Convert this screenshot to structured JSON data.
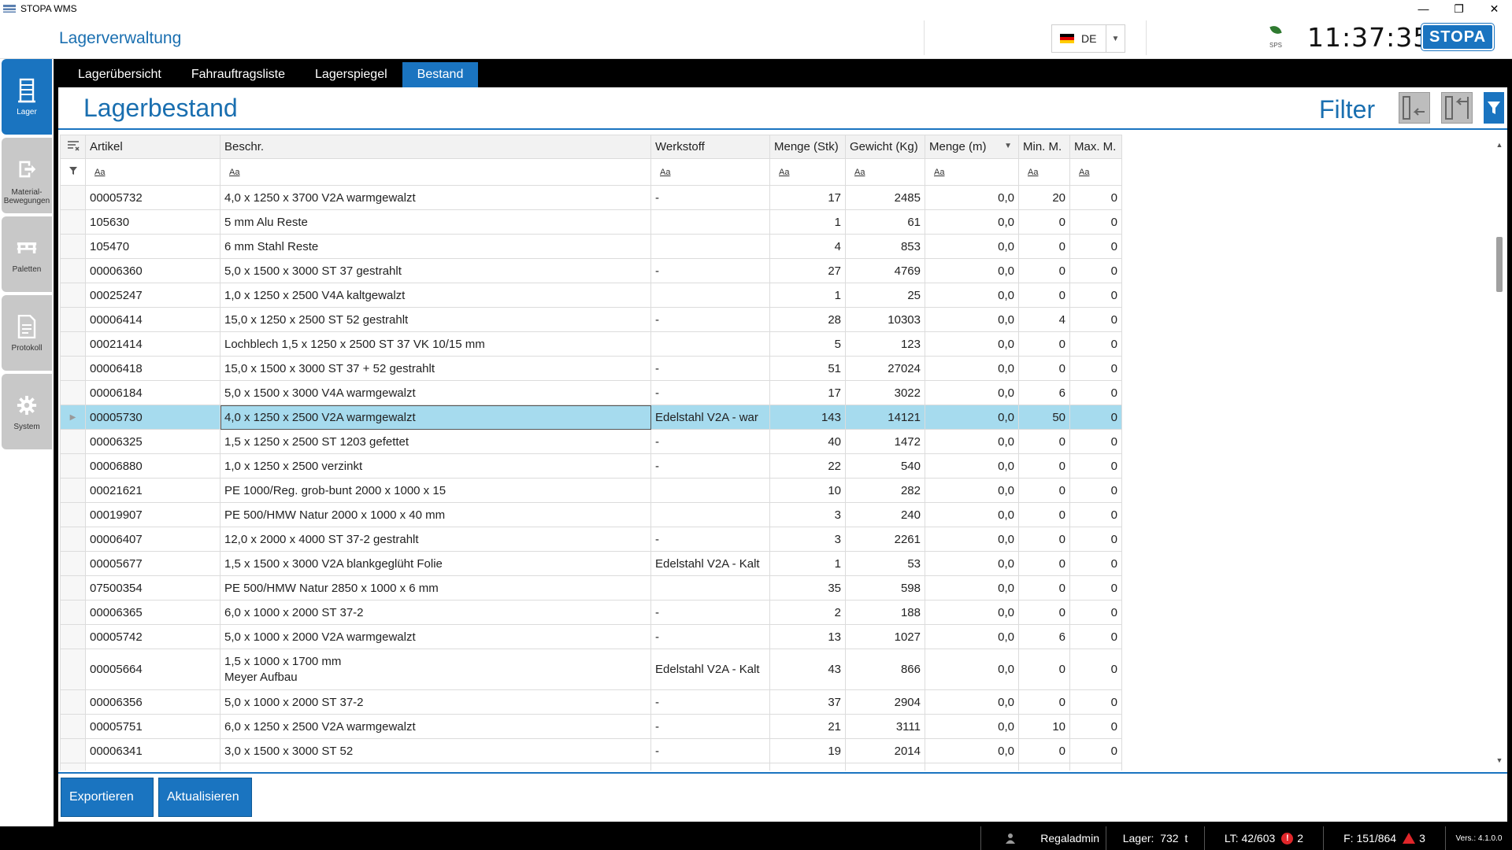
{
  "window": {
    "title": "STOPA WMS"
  },
  "header": {
    "heading": "Lagerverwaltung",
    "language": "DE",
    "sps_label": "SPS",
    "time": "11:37:35",
    "logo_text": "STOPA"
  },
  "sidebar": {
    "items": [
      {
        "label": "Lager",
        "icon": "warehouse-icon",
        "active": true
      },
      {
        "label": "Material-\nBewegungen",
        "icon": "material-movement-icon",
        "active": false
      },
      {
        "label": "Paletten",
        "icon": "pallet-icon",
        "active": false
      },
      {
        "label": "Protokoll",
        "icon": "document-icon",
        "active": false
      },
      {
        "label": "System",
        "icon": "gear-icon",
        "active": false
      }
    ]
  },
  "tabs": [
    {
      "label": "Lagerübersicht"
    },
    {
      "label": "Fahrauftragsliste"
    },
    {
      "label": "Lagerspiegel"
    },
    {
      "label": "Bestand",
      "active": true
    }
  ],
  "page": {
    "title": "Lagerbestand",
    "filter_label": "Filter"
  },
  "grid": {
    "columns": [
      {
        "label": "Artikel"
      },
      {
        "label": "Beschr."
      },
      {
        "label": "Werkstoff"
      },
      {
        "label": "Menge (Stk)"
      },
      {
        "label": "Gewicht (Kg)"
      },
      {
        "label": "Menge (m)"
      },
      {
        "label": "Min. M."
      },
      {
        "label": "Max. M."
      }
    ],
    "filter_placeholder": "Aa",
    "rows": [
      {
        "artikel": "00005732",
        "beschr": "4,0 x 1250 x 3700 V2A warmgewalzt",
        "werkstoff": "-",
        "stk": "17",
        "kg": "2485",
        "m": "0,0",
        "min": "20",
        "max": "0"
      },
      {
        "artikel": "105630",
        "beschr": "5 mm Alu Reste",
        "werkstoff": "",
        "stk": "1",
        "kg": "61",
        "m": "0,0",
        "min": "0",
        "max": "0"
      },
      {
        "artikel": "105470",
        "beschr": "6 mm Stahl Reste",
        "werkstoff": "",
        "stk": "4",
        "kg": "853",
        "m": "0,0",
        "min": "0",
        "max": "0"
      },
      {
        "artikel": "00006360",
        "beschr": "5,0 x 1500 x 3000 ST 37 gestrahlt",
        "werkstoff": "-",
        "stk": "27",
        "kg": "4769",
        "m": "0,0",
        "min": "0",
        "max": "0"
      },
      {
        "artikel": "00025247",
        "beschr": "1,0 x 1250 x 2500 V4A kaltgewalzt",
        "werkstoff": "",
        "stk": "1",
        "kg": "25",
        "m": "0,0",
        "min": "0",
        "max": "0"
      },
      {
        "artikel": "00006414",
        "beschr": "15,0 x 1250 x 2500 ST 52 gestrahlt",
        "werkstoff": "-",
        "stk": "28",
        "kg": "10303",
        "m": "0,0",
        "min": "4",
        "max": "0"
      },
      {
        "artikel": "00021414",
        "beschr": "Lochblech 1,5 x 1250 x 2500 ST 37 VK 10/15 mm",
        "werkstoff": "",
        "stk": "5",
        "kg": "123",
        "m": "0,0",
        "min": "0",
        "max": "0"
      },
      {
        "artikel": "00006418",
        "beschr": "15,0 x 1500 x 3000 ST 37 + 52 gestrahlt",
        "werkstoff": "-",
        "stk": "51",
        "kg": "27024",
        "m": "0,0",
        "min": "0",
        "max": "0"
      },
      {
        "artikel": "00006184",
        "beschr": "5,0 x 1500 x 3000 V4A warmgewalzt",
        "werkstoff": "-",
        "stk": "17",
        "kg": "3022",
        "m": "0,0",
        "min": "6",
        "max": "0"
      },
      {
        "artikel": "00005730",
        "beschr": "4,0 x 1250 x 2500 V2A warmgewalzt",
        "werkstoff": "Edelstahl V2A - war",
        "stk": "143",
        "kg": "14121",
        "m": "0,0",
        "min": "50",
        "max": "0",
        "selected": true
      },
      {
        "artikel": "00006325",
        "beschr": "1,5 x 1250 x 2500 ST 1203 gefettet",
        "werkstoff": "-",
        "stk": "40",
        "kg": "1472",
        "m": "0,0",
        "min": "0",
        "max": "0"
      },
      {
        "artikel": "00006880",
        "beschr": "1,0 x 1250 x 2500 verzinkt",
        "werkstoff": "-",
        "stk": "22",
        "kg": "540",
        "m": "0,0",
        "min": "0",
        "max": "0"
      },
      {
        "artikel": "00021621",
        "beschr": "PE 1000/Reg. grob-bunt 2000 x 1000 x 15",
        "werkstoff": "",
        "stk": "10",
        "kg": "282",
        "m": "0,0",
        "min": "0",
        "max": "0"
      },
      {
        "artikel": "00019907",
        "beschr": "PE 500/HMW Natur 2000 x 1000 x 40 mm",
        "werkstoff": "",
        "stk": "3",
        "kg": "240",
        "m": "0,0",
        "min": "0",
        "max": "0"
      },
      {
        "artikel": "00006407",
        "beschr": "12,0 x 2000 x 4000 ST 37-2 gestrahlt",
        "werkstoff": "-",
        "stk": "3",
        "kg": "2261",
        "m": "0,0",
        "min": "0",
        "max": "0"
      },
      {
        "artikel": "00005677",
        "beschr": "1,5 x 1500 x 3000 V2A blankgeglüht Folie",
        "werkstoff": "Edelstahl V2A - Kalt",
        "stk": "1",
        "kg": "53",
        "m": "0,0",
        "min": "0",
        "max": "0"
      },
      {
        "artikel": "07500354",
        "beschr": "PE 500/HMW Natur 2850 x 1000 x 6 mm",
        "werkstoff": "",
        "stk": "35",
        "kg": "598",
        "m": "0,0",
        "min": "0",
        "max": "0"
      },
      {
        "artikel": "00006365",
        "beschr": "6,0 x 1000 x 2000 ST 37-2",
        "werkstoff": "-",
        "stk": "2",
        "kg": "188",
        "m": "0,0",
        "min": "0",
        "max": "0"
      },
      {
        "artikel": "00005742",
        "beschr": "5,0 x 1000 x 2000 V2A warmgewalzt",
        "werkstoff": "-",
        "stk": "13",
        "kg": "1027",
        "m": "0,0",
        "min": "6",
        "max": "0"
      },
      {
        "artikel": "00005664",
        "beschr": "1,5 x 1000 x 1700 mm",
        "beschr2": "Meyer Aufbau",
        "werkstoff": "Edelstahl V2A - Kalt",
        "stk": "43",
        "kg": "866",
        "m": "0,0",
        "min": "0",
        "max": "0"
      },
      {
        "artikel": "00006356",
        "beschr": "5,0 x 1000 x 2000 ST 37-2",
        "werkstoff": "-",
        "stk": "37",
        "kg": "2904",
        "m": "0,0",
        "min": "0",
        "max": "0"
      },
      {
        "artikel": "00005751",
        "beschr": "6,0 x 1250 x 2500 V2A warmgewalzt",
        "werkstoff": "-",
        "stk": "21",
        "kg": "3111",
        "m": "0,0",
        "min": "10",
        "max": "0"
      },
      {
        "artikel": "00006341",
        "beschr": "3,0 x 1500 x 3000 ST 52",
        "werkstoff": "-",
        "stk": "19",
        "kg": "2014",
        "m": "0,0",
        "min": "0",
        "max": "0"
      },
      {
        "artikel": "",
        "beschr": "",
        "werkstoff": "",
        "stk": "",
        "kg": "",
        "m": "",
        "min": "",
        "max": ""
      }
    ]
  },
  "actions": {
    "export": "Exportieren",
    "refresh": "Aktualisieren"
  },
  "status": {
    "user": "Regaladmin",
    "lager_label": "Lager:",
    "lager_value": "732",
    "lager_unit": "t",
    "lt": "LT: 42/603",
    "errors": "2",
    "f": "F: 151/864",
    "warnings": "3",
    "version": "Vers.: 4.1.0.0"
  },
  "colors": {
    "accent": "#1a74c0",
    "selected_row": "#a6dbee",
    "error": "#e0262a"
  }
}
